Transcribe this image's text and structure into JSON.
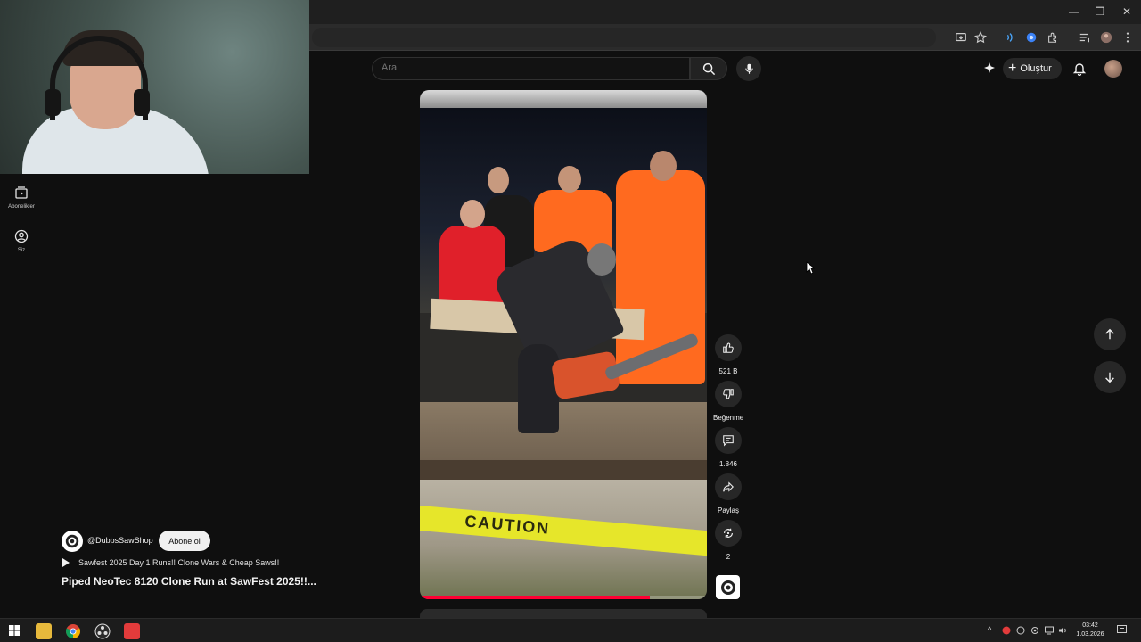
{
  "browser": {
    "window_controls": [
      "—",
      "❐",
      "✕"
    ]
  },
  "youtube": {
    "search": {
      "placeholder": "Ara"
    },
    "create_label": "Oluştur"
  },
  "sidebar": {
    "items": [
      {
        "label": "Abonelikler",
        "icon": "subscriptions-icon"
      },
      {
        "label": "Siz",
        "icon": "you-icon"
      }
    ]
  },
  "video": {
    "progress_fraction": 0.8
  },
  "actions": {
    "like_count": "521 B",
    "dislike_label": "Beğenme",
    "comment_count": "1.846",
    "share_label": "Paylaş",
    "remix_count": "2"
  },
  "meta": {
    "channel": "@DubbsSawShop",
    "subscribe_label": "Abone ol",
    "playlist": "Sawfest 2025 Day 1 Runs!! Clone Wars & Cheap Saws!!",
    "title": "Piped NeoTec 8120 Clone Run at SawFest 2025!!..."
  },
  "scene": {
    "tape_text": "CAUTION"
  },
  "taskbar": {
    "time": "03:42",
    "date": "1.03.2026"
  },
  "colors": {
    "accent_red": "#ff0033",
    "background": "#0f0f0f",
    "chip": "#272727"
  }
}
